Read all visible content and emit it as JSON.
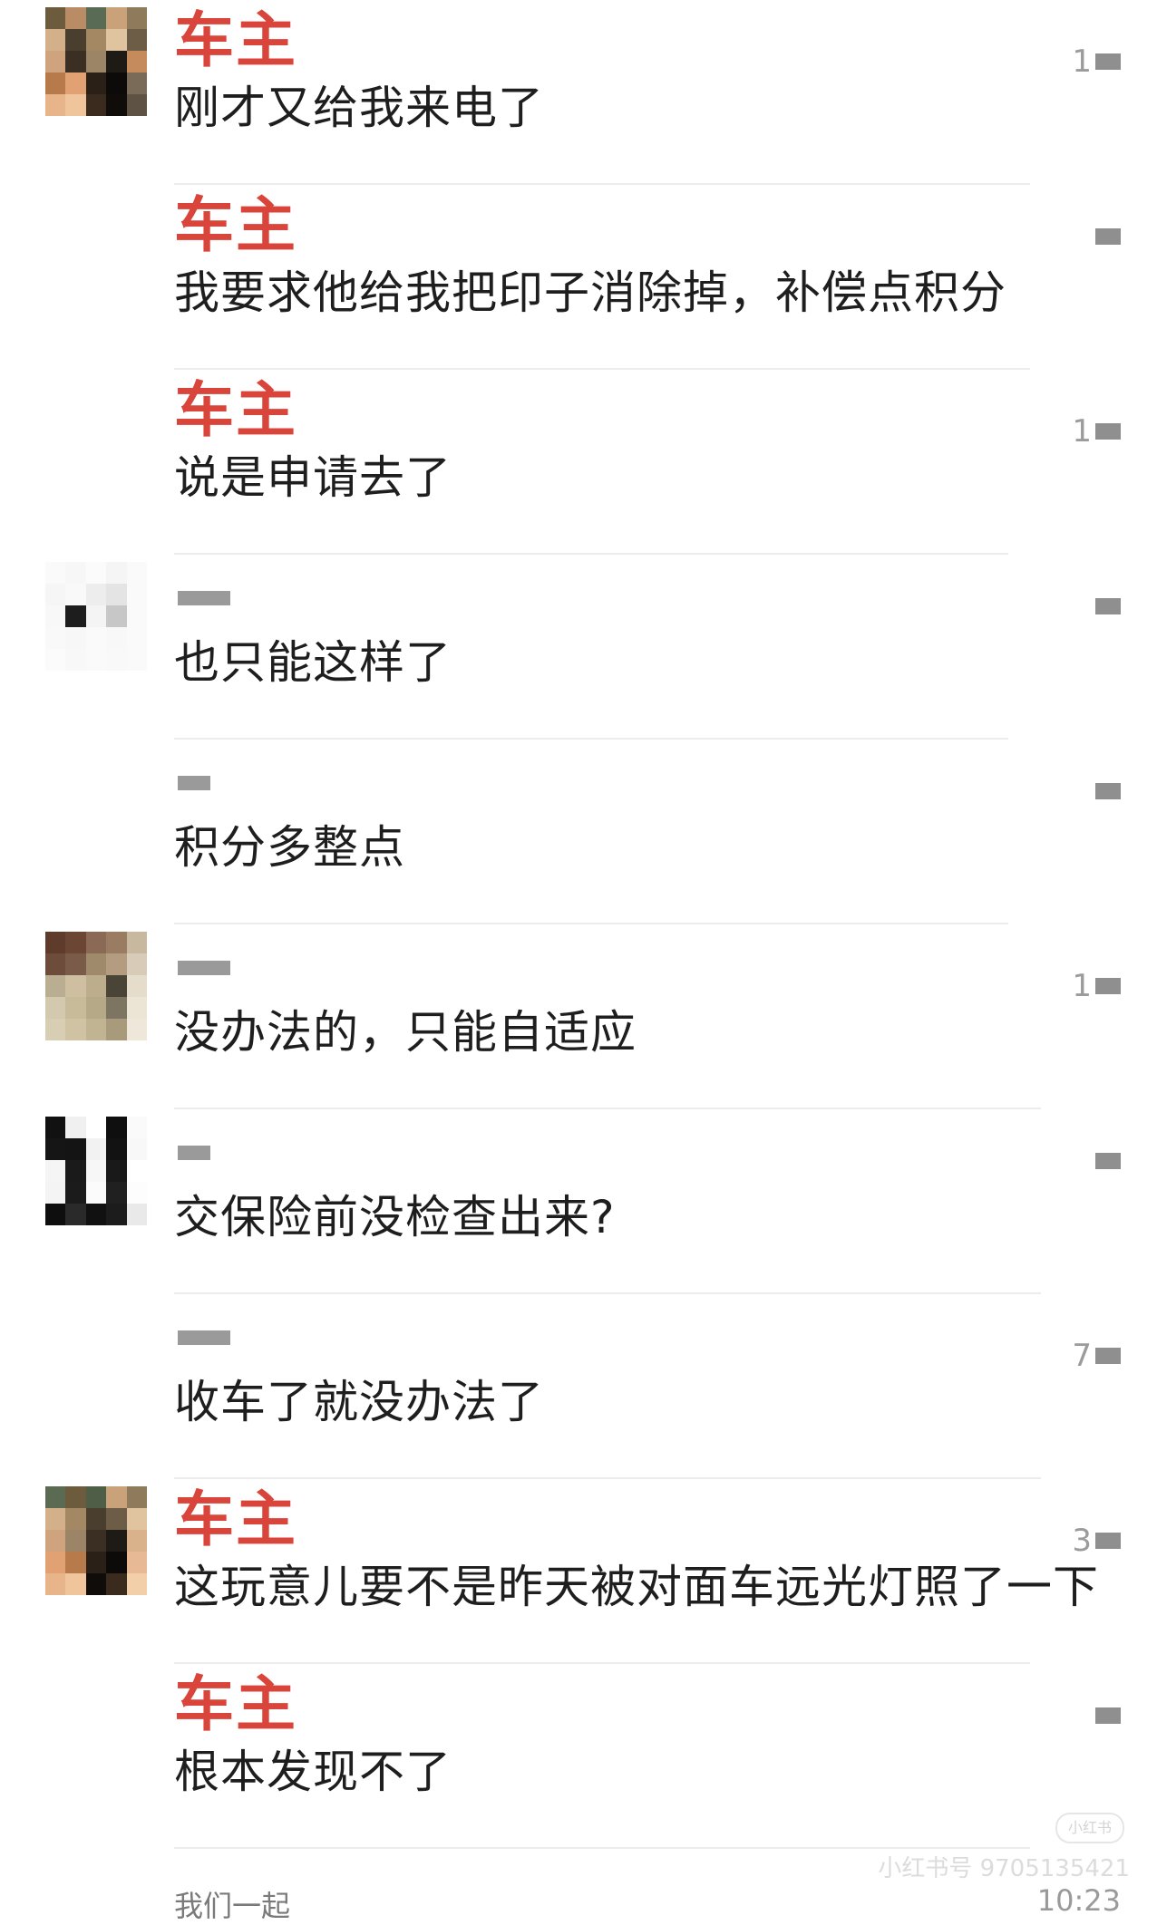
{
  "messages": [
    {
      "sender": "车主",
      "text": "刚才又给我来电了",
      "time": "1",
      "avatar": [
        "#6d5b3e",
        "#b98c66",
        "#5a6b55",
        "#c9a27a",
        "#8f7a5c",
        "#d4b08a",
        "#4a3f2f",
        "#a48863",
        "#e0c4a0",
        "#6e5d46",
        "#cfa37d",
        "#3a2f22",
        "#9c8466",
        "#1e1a15",
        "#c58b5d",
        "#b77a4a",
        "#e2a172",
        "#2a2018",
        "#0d0b09",
        "#7a6b58",
        "#e8b48a",
        "#f0c59c",
        "#3b2a1e",
        "#100c09",
        "#5e5244"
      ]
    },
    {
      "sender": "车主",
      "text": "我要求他给我把印子消除掉，补偿点积分",
      "time": "",
      "avatar": []
    },
    {
      "sender": "车主",
      "text": "说是申请去了",
      "time": "1",
      "avatar": []
    },
    {
      "sender": "",
      "text": "也只能这样了",
      "time": "",
      "avatar": [
        "#fafafa",
        "#f7f7f7",
        "#fbfbfb",
        "#f5f5f5",
        "#fafafa",
        "#f6f6f6",
        "#f9f9f9",
        "#ededed",
        "#e4e4e4",
        "#fafafa",
        "#f8f8f8",
        "#1d1d1d",
        "#f4f4f4",
        "#c7c7c7",
        "#fafafa",
        "#f9f9f9",
        "#f7f7f7",
        "#fafafa",
        "#f8f8f8",
        "#fafafa",
        "#fbfbfb",
        "#f8f8f8",
        "#fafafa",
        "#f9f9f9",
        "#fafafa"
      ]
    },
    {
      "sender": "",
      "text": "积分多整点",
      "time": "",
      "avatar": []
    },
    {
      "sender": "",
      "text": "没办法的，只能自适应",
      "time": "1",
      "avatar": [
        "#5e3b2a",
        "#6b4635",
        "#8a6a55",
        "#9a7c63",
        "#c8b8a0",
        "#6e4c3c",
        "#7a5a48",
        "#a08a6c",
        "#b39c7f",
        "#d8ccb8",
        "#b9ae92",
        "#cdbf9f",
        "#bcae8c",
        "#4a4436",
        "#e6dccc",
        "#d3c9ae",
        "#c7bb9a",
        "#b5a987",
        "#7d7562",
        "#ece4d4",
        "#d8ceb4",
        "#cfc3a4",
        "#c0b493",
        "#a79b7b",
        "#efe8da"
      ]
    },
    {
      "sender": "",
      "text": "交保险前没检查出来?",
      "time": "",
      "avatar": [
        "#111111",
        "#f0f0f0",
        "#ffffff",
        "#0f0f0f",
        "#fafafa",
        "#151515",
        "#141414",
        "#f2f2f2",
        "#121212",
        "#f8f8f8",
        "#f5f5f5",
        "#1a1a1a",
        "#f7f7f7",
        "#191919",
        "#ffffff",
        "#f4f4f4",
        "#1b1b1b",
        "#fbfbfb",
        "#202020",
        "#fdfdfd",
        "#0e0e0e",
        "#2a2a2a",
        "#111111",
        "#1c1c1c",
        "#e9e9e9"
      ]
    },
    {
      "sender": "",
      "text": "收车了就没办法了",
      "time": "7",
      "avatar": []
    },
    {
      "sender": "车主",
      "text": "这玩意儿要不是昨天被对面车远光灯照了一下",
      "time": "3",
      "avatar": [
        "#5b6a52",
        "#6d5b3e",
        "#4f5e47",
        "#c9a27a",
        "#8f7a5c",
        "#d4b08a",
        "#a48863",
        "#4a3f2f",
        "#6e5d46",
        "#e0c4a0",
        "#cfa37d",
        "#9c8466",
        "#3a2f22",
        "#1e1a15",
        "#d9b28c",
        "#e2a172",
        "#b77a4a",
        "#2a2018",
        "#0d0b09",
        "#e7b994",
        "#e8b48a",
        "#f0c59c",
        "#100c09",
        "#3b2a1e",
        "#f2cfa8"
      ]
    },
    {
      "sender": "车主",
      "text": "根本发现不了",
      "time": "",
      "avatar": []
    }
  ],
  "watermark": {
    "logo": "小红书",
    "text": "小红书号 9705135421"
  },
  "footer": {
    "text": "我们一起",
    "time": "10:23"
  }
}
